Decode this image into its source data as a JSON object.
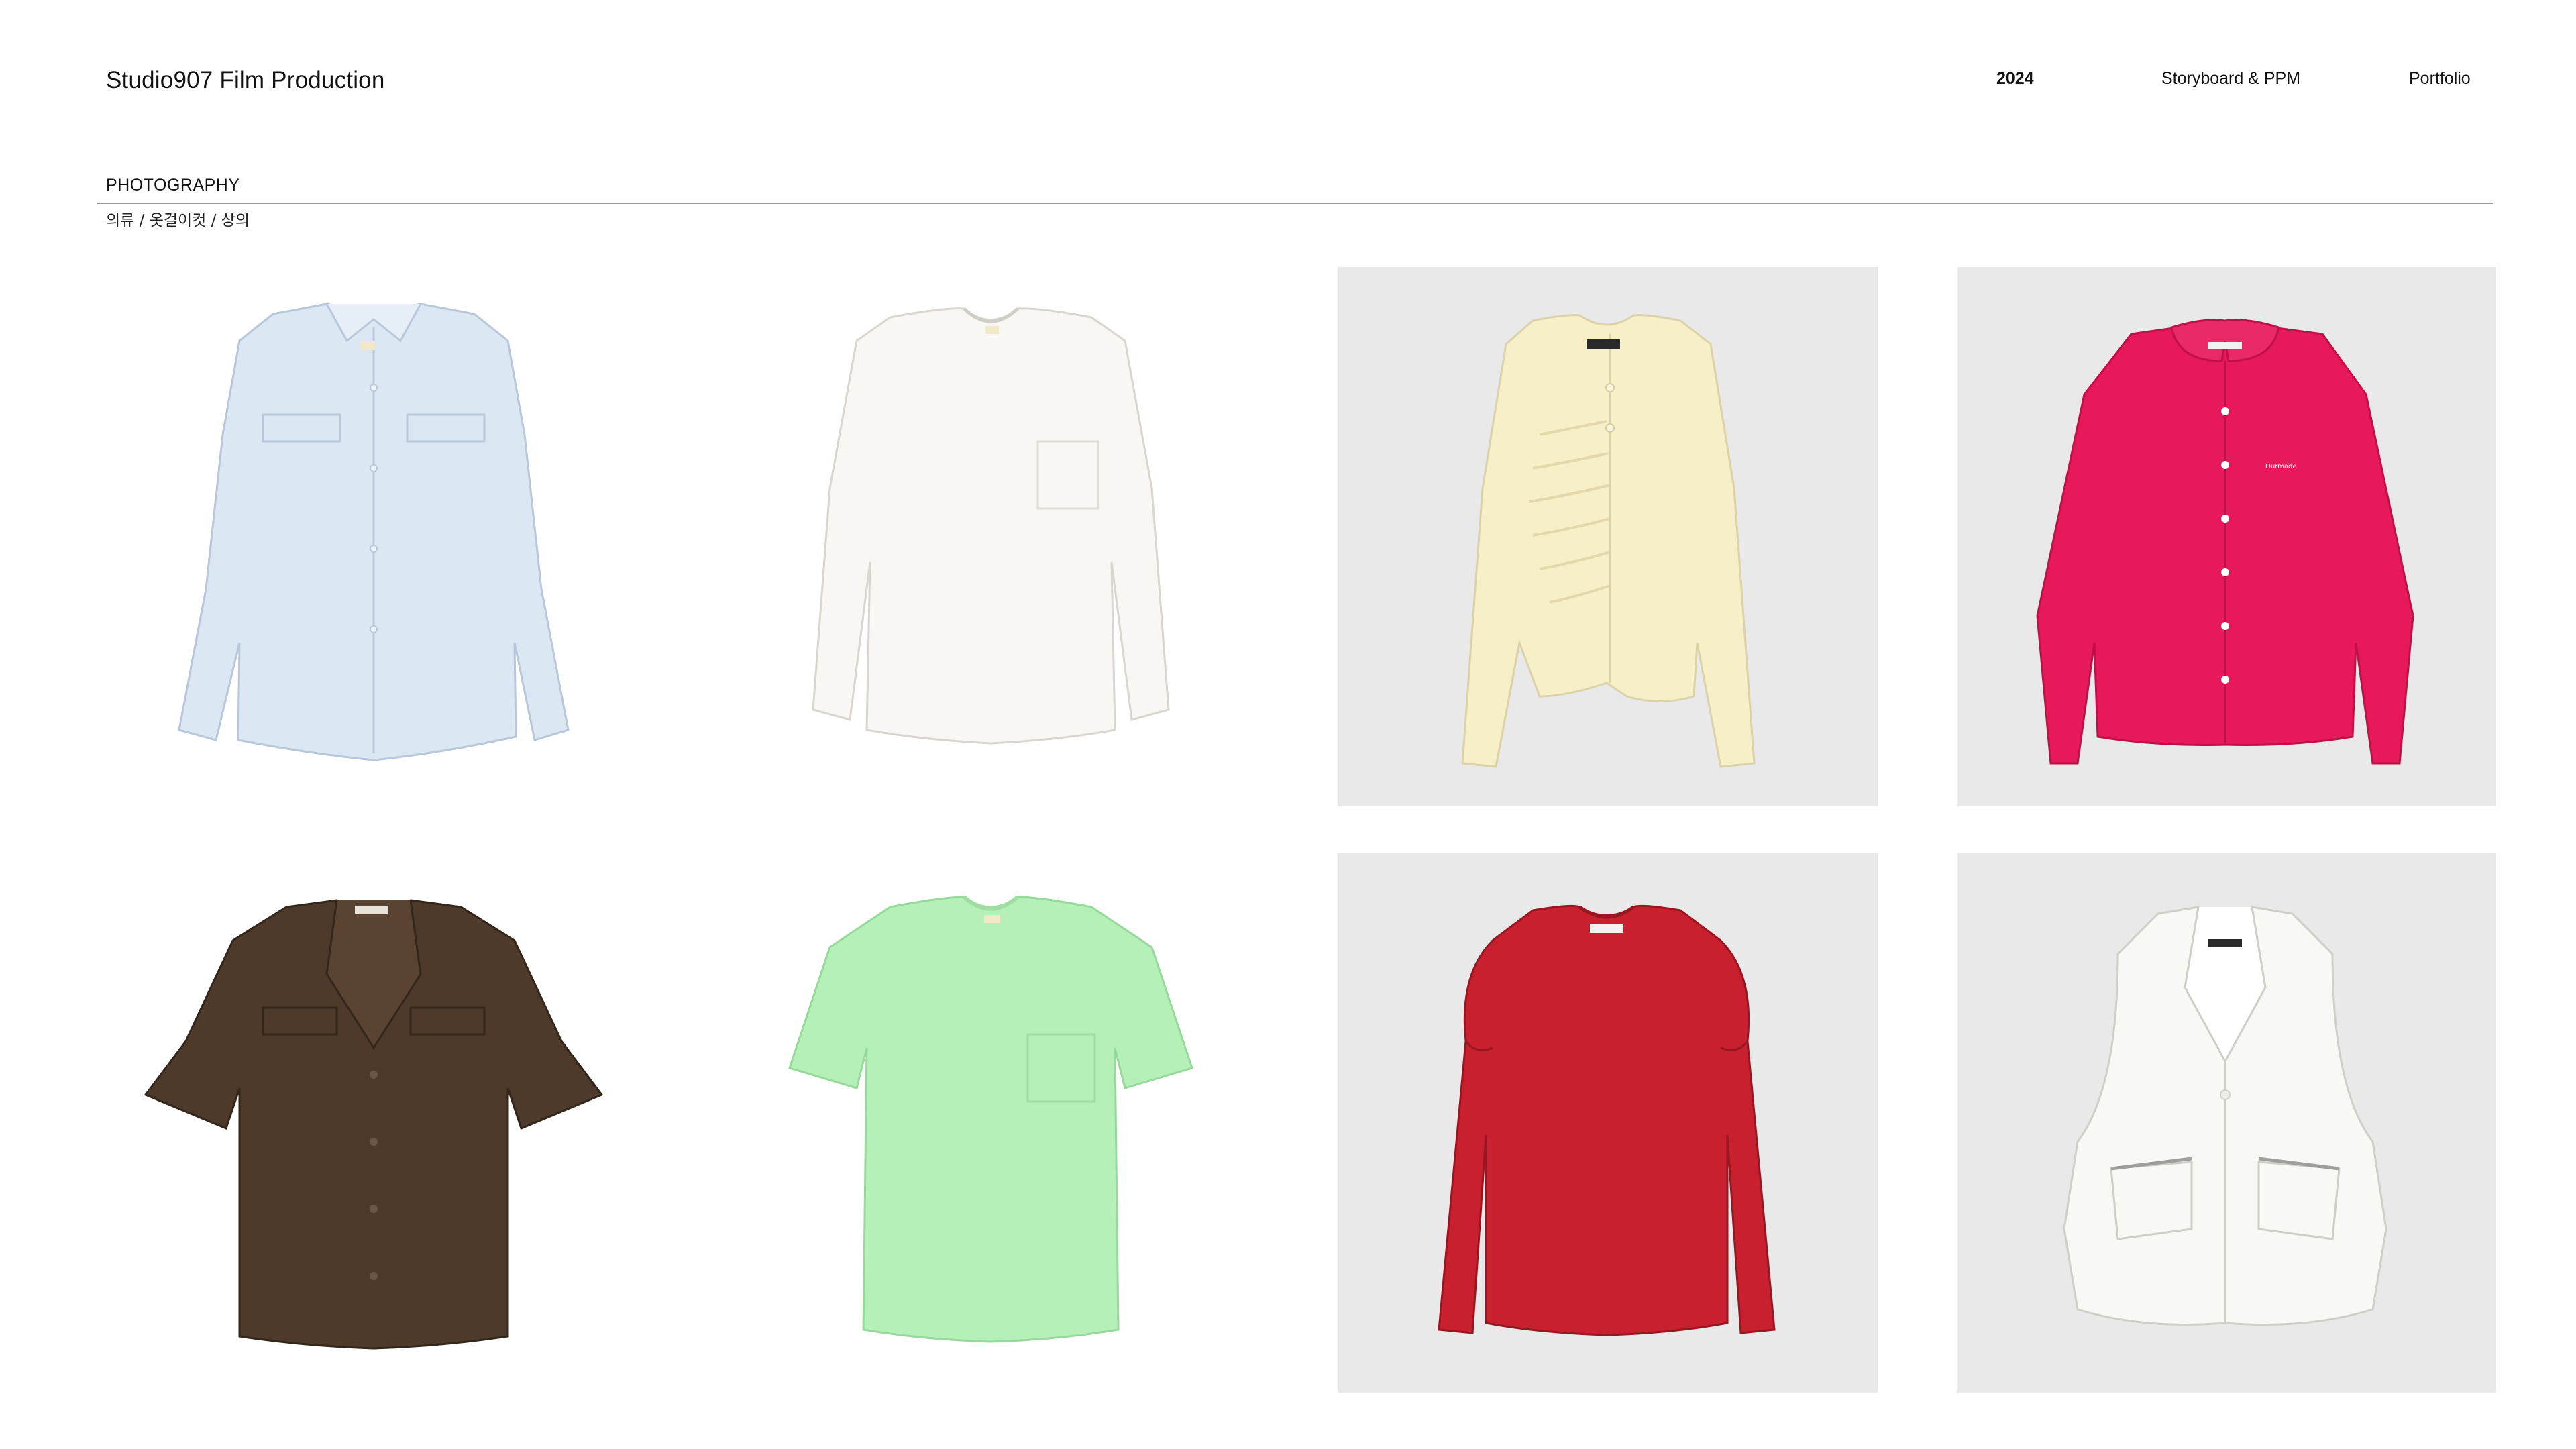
{
  "header": {
    "brand": "Studio907 Film Production",
    "nav": [
      {
        "label": "2024",
        "active": true
      },
      {
        "label": "Storyboard & PPM",
        "active": false
      },
      {
        "label": "Portfolio",
        "active": false
      }
    ]
  },
  "section": {
    "title": "PHOTOGRAPHY",
    "breadcrumb": "의류 / 옷걸이컷 / 상의"
  },
  "gallery": [
    {
      "name": "light-blue-shirt",
      "background": "white",
      "garment_color": "#dbe6f3"
    },
    {
      "name": "white-long-sleeve-tee",
      "background": "white",
      "garment_color": "#f7f6f2"
    },
    {
      "name": "cream-ruched-cardigan",
      "background": "grey",
      "garment_color": "#f7efc8"
    },
    {
      "name": "pink-collared-blouse",
      "background": "grey",
      "garment_color": "#e8195a"
    },
    {
      "name": "brown-short-sleeve-shirt",
      "background": "white",
      "garment_color": "#4e3a2a"
    },
    {
      "name": "mint-pocket-tee",
      "background": "white",
      "garment_color": "#b5f0b8"
    },
    {
      "name": "red-puff-sleeve-top",
      "background": "grey",
      "garment_color": "#c8202e"
    },
    {
      "name": "white-zip-vest",
      "background": "grey",
      "garment_color": "#f8f8f5"
    }
  ],
  "colors": {
    "text": "#111111",
    "divider": "#9a9a9a",
    "tile_grey": "#e9e9e9"
  }
}
